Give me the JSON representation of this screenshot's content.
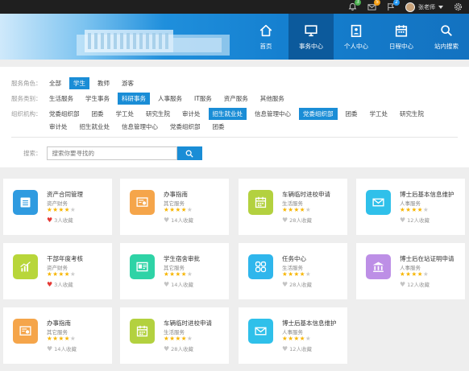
{
  "topbar": {
    "notif_count": "3",
    "mail_count": "5",
    "flag_count": "2",
    "user_name": "张老师"
  },
  "nav": [
    {
      "label": "首页",
      "icon": "home-icon"
    },
    {
      "label": "事务中心",
      "icon": "monitor-icon",
      "active": true
    },
    {
      "label": "个人中心",
      "icon": "user-doc-icon"
    },
    {
      "label": "日程中心",
      "icon": "calendar-icon"
    },
    {
      "label": "站内搜索",
      "icon": "search-icon"
    }
  ],
  "filters": {
    "role": {
      "label": "服务角色：",
      "options": [
        "全部",
        "学生",
        "教师",
        "游客"
      ],
      "selected": "学生"
    },
    "category": {
      "label": "服务类别：",
      "options": [
        "生活服务",
        "学生事务",
        "科研事务",
        "人事服务",
        "IT服务",
        "资产服务",
        "其他服务"
      ],
      "selected": "科研事务"
    },
    "org": {
      "label": "组织机构：",
      "options": [
        "党委组织部",
        "团委",
        "学工处",
        "研究生院",
        "审计处",
        "招生就业处",
        "信息管理中心",
        "党委组织部",
        "团委",
        "学工处",
        "研究生院"
      ],
      "options2": [
        "审计处",
        "招生就业处",
        "信息管理中心",
        "党委组织部",
        "团委"
      ],
      "selected_index": [
        5,
        7
      ]
    }
  },
  "search": {
    "label": "搜索：",
    "placeholder": "搜索你要寻找的"
  },
  "cards": [
    {
      "title": "资产合同管理",
      "category": "资产财务",
      "stars": 4,
      "fav": "3人收藏",
      "fav_active": true,
      "icon": "document-list-icon",
      "color": "#2f9be0"
    },
    {
      "title": "办事指南",
      "category": "其它服务",
      "stars": 4,
      "fav": "14人收藏",
      "fav_active": false,
      "icon": "certificate-icon",
      "color": "#f5a54a"
    },
    {
      "title": "车辆临时进校申请",
      "category": "生活服务",
      "stars": 4,
      "fav": "28人收藏",
      "fav_active": false,
      "icon": "calendar-grid-icon",
      "color": "#b3d13f"
    },
    {
      "title": "博士后基本信息维护",
      "category": "人事服务",
      "stars": 4,
      "fav": "12人收藏",
      "fav_active": false,
      "icon": "mail-icon",
      "color": "#2fc0ea"
    },
    {
      "title": "干部年度考核",
      "category": "资产财务",
      "stars": 4,
      "fav": "3人收藏",
      "fav_active": true,
      "icon": "bar-chart-icon",
      "color": "#b8d63a"
    },
    {
      "title": "学生宿舍审批",
      "category": "其它服务",
      "stars": 4,
      "fav": "14人收藏",
      "fav_active": false,
      "icon": "id-card-icon",
      "color": "#2ed3a6"
    },
    {
      "title": "任务中心",
      "category": "生活服务",
      "stars": 4,
      "fav": "28人收藏",
      "fav_active": false,
      "icon": "grid-apps-icon",
      "color": "#2fb6ec"
    },
    {
      "title": "博士后在站证明申请",
      "category": "人事服务",
      "stars": 4,
      "fav": "12人收藏",
      "fav_active": false,
      "icon": "bank-icon",
      "color": "#bd8fe6"
    },
    {
      "title": "办事指南",
      "category": "其它服务",
      "stars": 4,
      "fav": "14人收藏",
      "fav_active": false,
      "icon": "certificate-icon",
      "color": "#f5a54a"
    },
    {
      "title": "车辆临时进校申请",
      "category": "生活服务",
      "stars": 4,
      "fav": "28人收藏",
      "fav_active": false,
      "icon": "calendar-grid-icon",
      "color": "#b3d13f"
    },
    {
      "title": "博士后基本信息维护",
      "category": "人事服务",
      "stars": 4,
      "fav": "12人收藏",
      "fav_active": false,
      "icon": "mail-icon",
      "color": "#2fc0ea"
    }
  ]
}
